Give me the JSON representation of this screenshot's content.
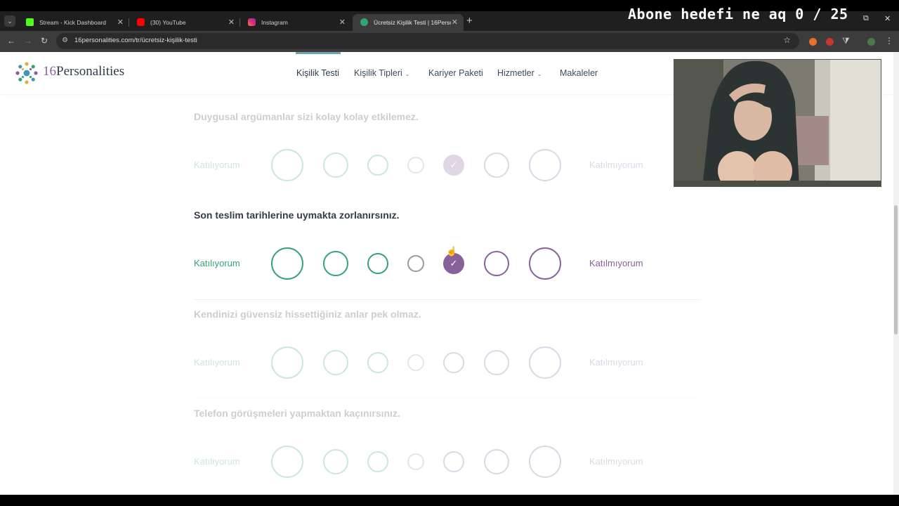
{
  "browser": {
    "tabs": [
      {
        "title": "Stream - Kick Dashboard",
        "favicon_color": "#53fc18",
        "active": false
      },
      {
        "title": "(30) YouTube",
        "favicon_color": "#ff0000",
        "active": false
      },
      {
        "title": "Instagram",
        "favicon_color": "#d6249f",
        "active": false
      },
      {
        "title": "Ücretsiz Kişilik Testi | 16Personalities",
        "favicon_color": "#33a474",
        "active": true
      }
    ],
    "url": "16personalities.com/tr/ücretsiz-kişilik-testi",
    "overlay_text": "Abone hedefi ne aq 0 / 25"
  },
  "site": {
    "logo_number": "16",
    "logo_name": "Personalities",
    "nav": [
      {
        "label": "Kişilik Testi",
        "active": true,
        "dropdown": false
      },
      {
        "label": "Kişilik Tipleri",
        "active": false,
        "dropdown": true
      },
      {
        "label": "Kariyer Paketi",
        "active": false,
        "dropdown": false
      },
      {
        "label": "Hizmetler",
        "active": false,
        "dropdown": true
      },
      {
        "label": "Makaleler",
        "active": false,
        "dropdown": false
      }
    ]
  },
  "test": {
    "agree_label": "Katılıyorum",
    "disagree_label": "Katılmıyorum",
    "questions": [
      {
        "text": "Duygusal argümanlar sizi kolay kolay etkilemez.",
        "selected": 5,
        "faded": true
      },
      {
        "text": "Son teslim tarihlerine uymakta zorlanırsınız.",
        "selected": 5,
        "faded": false
      },
      {
        "text": "Kendinizi güvensiz hissettiğiniz anlar pek olmaz.",
        "selected": 0,
        "faded": true
      },
      {
        "text": "Telefon görüşmeleri yapmaktan kaçınırsınız.",
        "selected": 0,
        "faded": true
      }
    ]
  },
  "colors": {
    "agree": "#33a474",
    "disagree": "#88619a",
    "neutral": "#9a9a9a"
  }
}
